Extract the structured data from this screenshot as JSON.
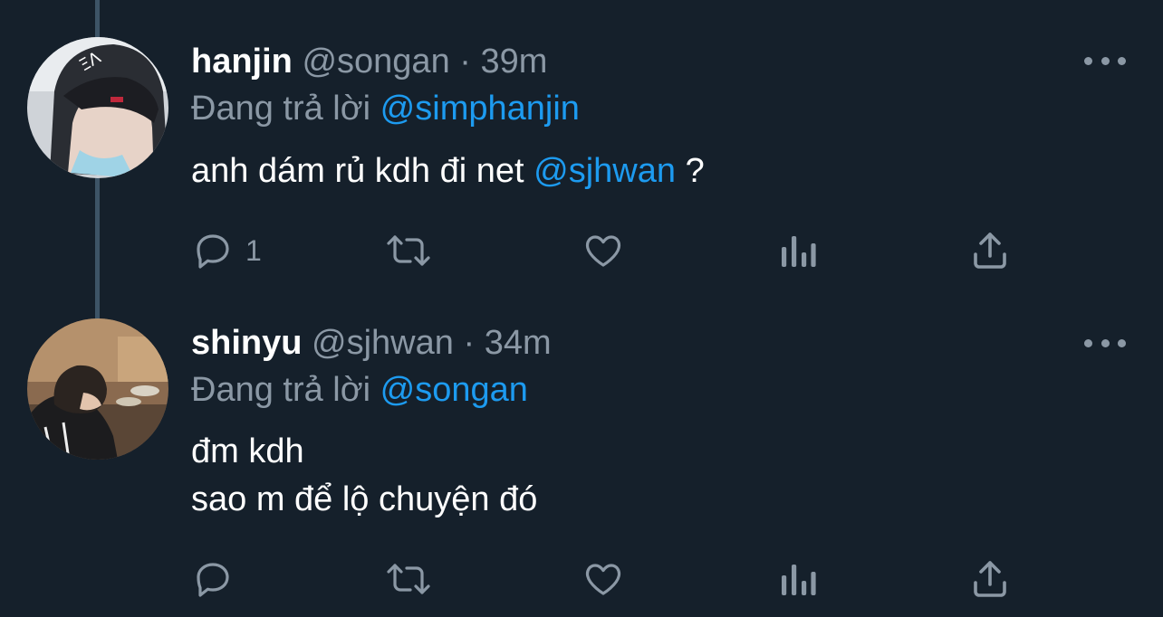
{
  "colors": {
    "background": "#15202b",
    "muted": "#8b98a5",
    "accent": "#1d9bf0",
    "thread_line": "#3d5466"
  },
  "tweets": [
    {
      "display_name": "hanjin",
      "handle": "@songan",
      "separator": "·",
      "time": "39m",
      "reply_prefix": "Đang trả lời",
      "reply_to": "@simphanjin",
      "body_text": "anh dám rủ kdh đi net",
      "body_mention": "@sjhwan",
      "body_suffix": " ?",
      "reply_count": "1",
      "icons": [
        "reply-icon",
        "retweet-icon",
        "like-icon",
        "views-icon",
        "share-icon",
        "more-icon"
      ]
    },
    {
      "display_name": "shinyu",
      "handle": "@sjhwan",
      "separator": "·",
      "time": "34m",
      "reply_prefix": "Đang trả lời",
      "reply_to": "@songan",
      "body_line_1": "đm kdh",
      "body_line_2": "sao m để lộ chuyện đó",
      "icons": [
        "reply-icon",
        "retweet-icon",
        "like-icon",
        "views-icon",
        "share-icon",
        "more-icon"
      ]
    }
  ]
}
